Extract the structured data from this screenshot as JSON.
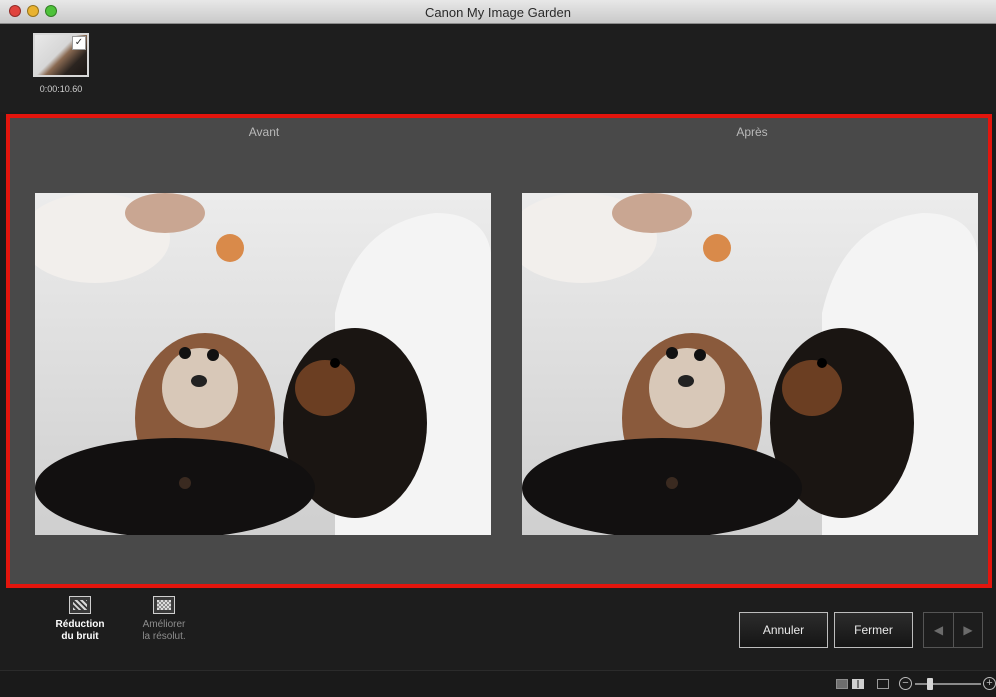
{
  "window": {
    "title": "Canon My Image Garden"
  },
  "filmstrip": {
    "items": [
      {
        "time": "0:00:10.60",
        "selected": true
      }
    ]
  },
  "preview": {
    "before_label": "Avant",
    "after_label": "Après",
    "border_color": "#e3150d"
  },
  "tools": {
    "noise": {
      "label_line1": "Réduction",
      "label_line2": "du bruit",
      "icon": "noise-reduction-icon",
      "active": true
    },
    "resolution": {
      "label_line1": "Améliorer",
      "label_line2": "la résolut.",
      "icon": "enhance-resolution-icon",
      "active": false
    }
  },
  "buttons": {
    "cancel": "Annuler",
    "close": "Fermer"
  },
  "nav": {
    "prev_icon": "arrow-left-icon",
    "next_icon": "arrow-right-icon"
  },
  "statusbar": {
    "zoom_minus": "−",
    "zoom_plus": "+",
    "zoom_level": 0.2
  }
}
